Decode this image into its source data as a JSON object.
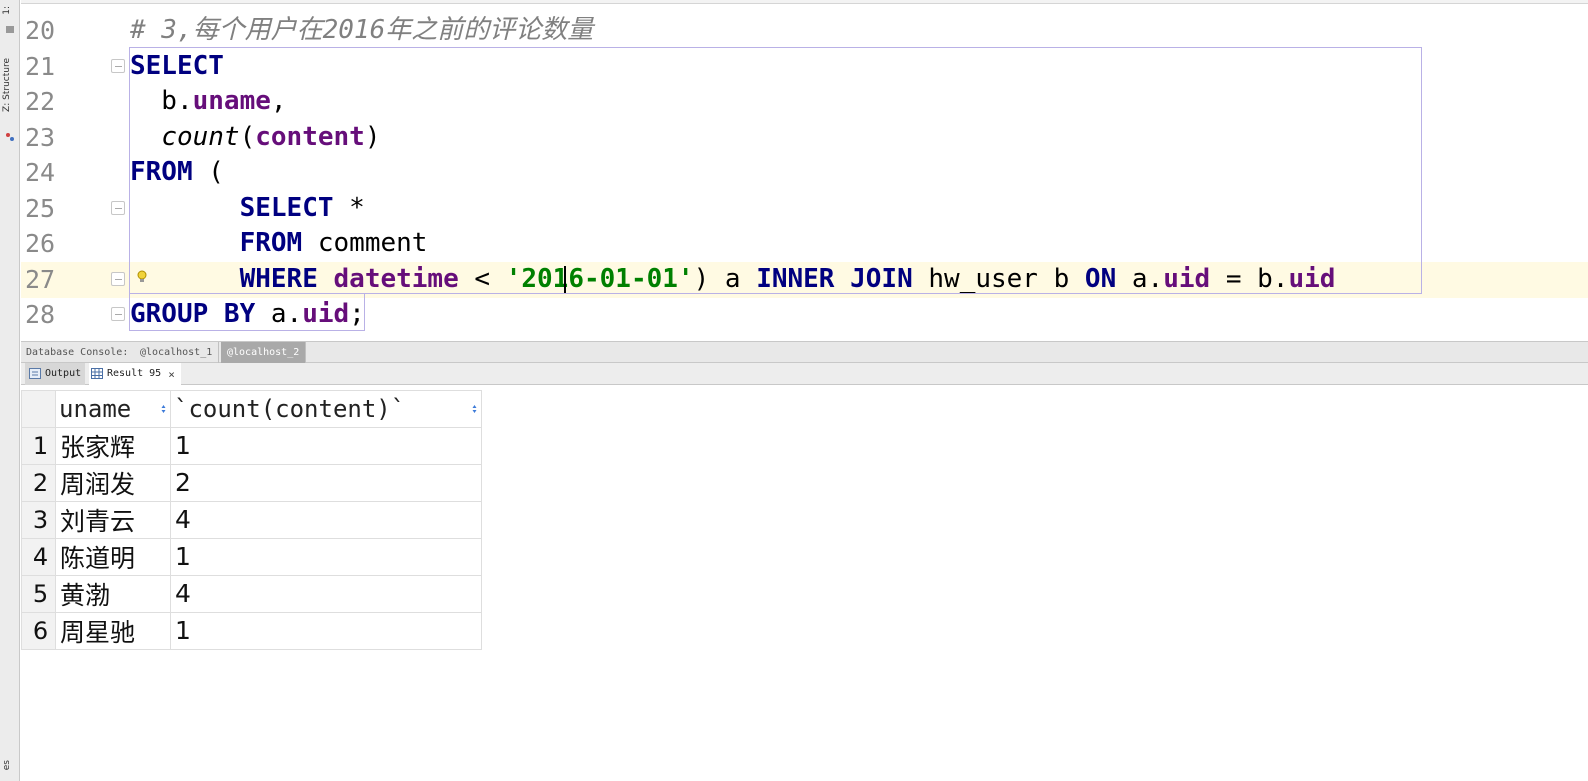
{
  "left_strip": {
    "tab1": "1:",
    "structure": "Z: Structure",
    "bottom": "es"
  },
  "editor": {
    "lines": [
      {
        "num": "20"
      },
      {
        "num": "21"
      },
      {
        "num": "22"
      },
      {
        "num": "23"
      },
      {
        "num": "24"
      },
      {
        "num": "25"
      },
      {
        "num": "26"
      },
      {
        "num": "27"
      },
      {
        "num": "28"
      }
    ],
    "tokens": {
      "comment": "# 3,每个用户在2016年之前的评论数量",
      "select": "SELECT",
      "b_dot": "  b.",
      "uname": "uname",
      "comma": ",",
      "indent2": "  ",
      "count": "count",
      "lparen": "(",
      "content": "content",
      "rparen": ")",
      "from": "FROM",
      "from_paren": " (",
      "indent8": "       ",
      "select2": "SELECT",
      "star": " *",
      "from2": "FROM",
      "comment_tbl": " comment",
      "where": "WHERE",
      "datetime": "datetime",
      "lt": " < ",
      "date_str": "'2016-01-01'",
      "alias_a": ") a ",
      "inner_join": "INNER JOIN",
      "hw_user": " hw_user b ",
      "on": "ON",
      "a_dot": " a.",
      "uid1": "uid",
      "eq_b": " = b.",
      "uid2": "uid",
      "group_by": "GROUP BY",
      "a_dot2": " a.",
      "uid3": "uid",
      "semi": ";"
    }
  },
  "console": {
    "label": "Database Console:",
    "tabs": [
      "@localhost_1",
      "@localhost_2"
    ],
    "active": "@localhost_2"
  },
  "results": {
    "output_tab": "Output",
    "result_tab": "Result 95",
    "close": "×",
    "columns": [
      "uname",
      "`count(content)`"
    ],
    "rows": [
      {
        "n": "1",
        "uname": "张家辉",
        "count": "1"
      },
      {
        "n": "2",
        "uname": "周润发",
        "count": "2"
      },
      {
        "n": "3",
        "uname": "刘青云",
        "count": "4"
      },
      {
        "n": "4",
        "uname": "陈道明",
        "count": "1"
      },
      {
        "n": "5",
        "uname": "黄渤",
        "count": "4"
      },
      {
        "n": "6",
        "uname": "周星驰",
        "count": "1"
      }
    ]
  },
  "colors": {
    "keyword": "#000080",
    "field": "#660e7a",
    "string": "#008000",
    "comment": "#808080",
    "current_line": "#fffae3"
  }
}
